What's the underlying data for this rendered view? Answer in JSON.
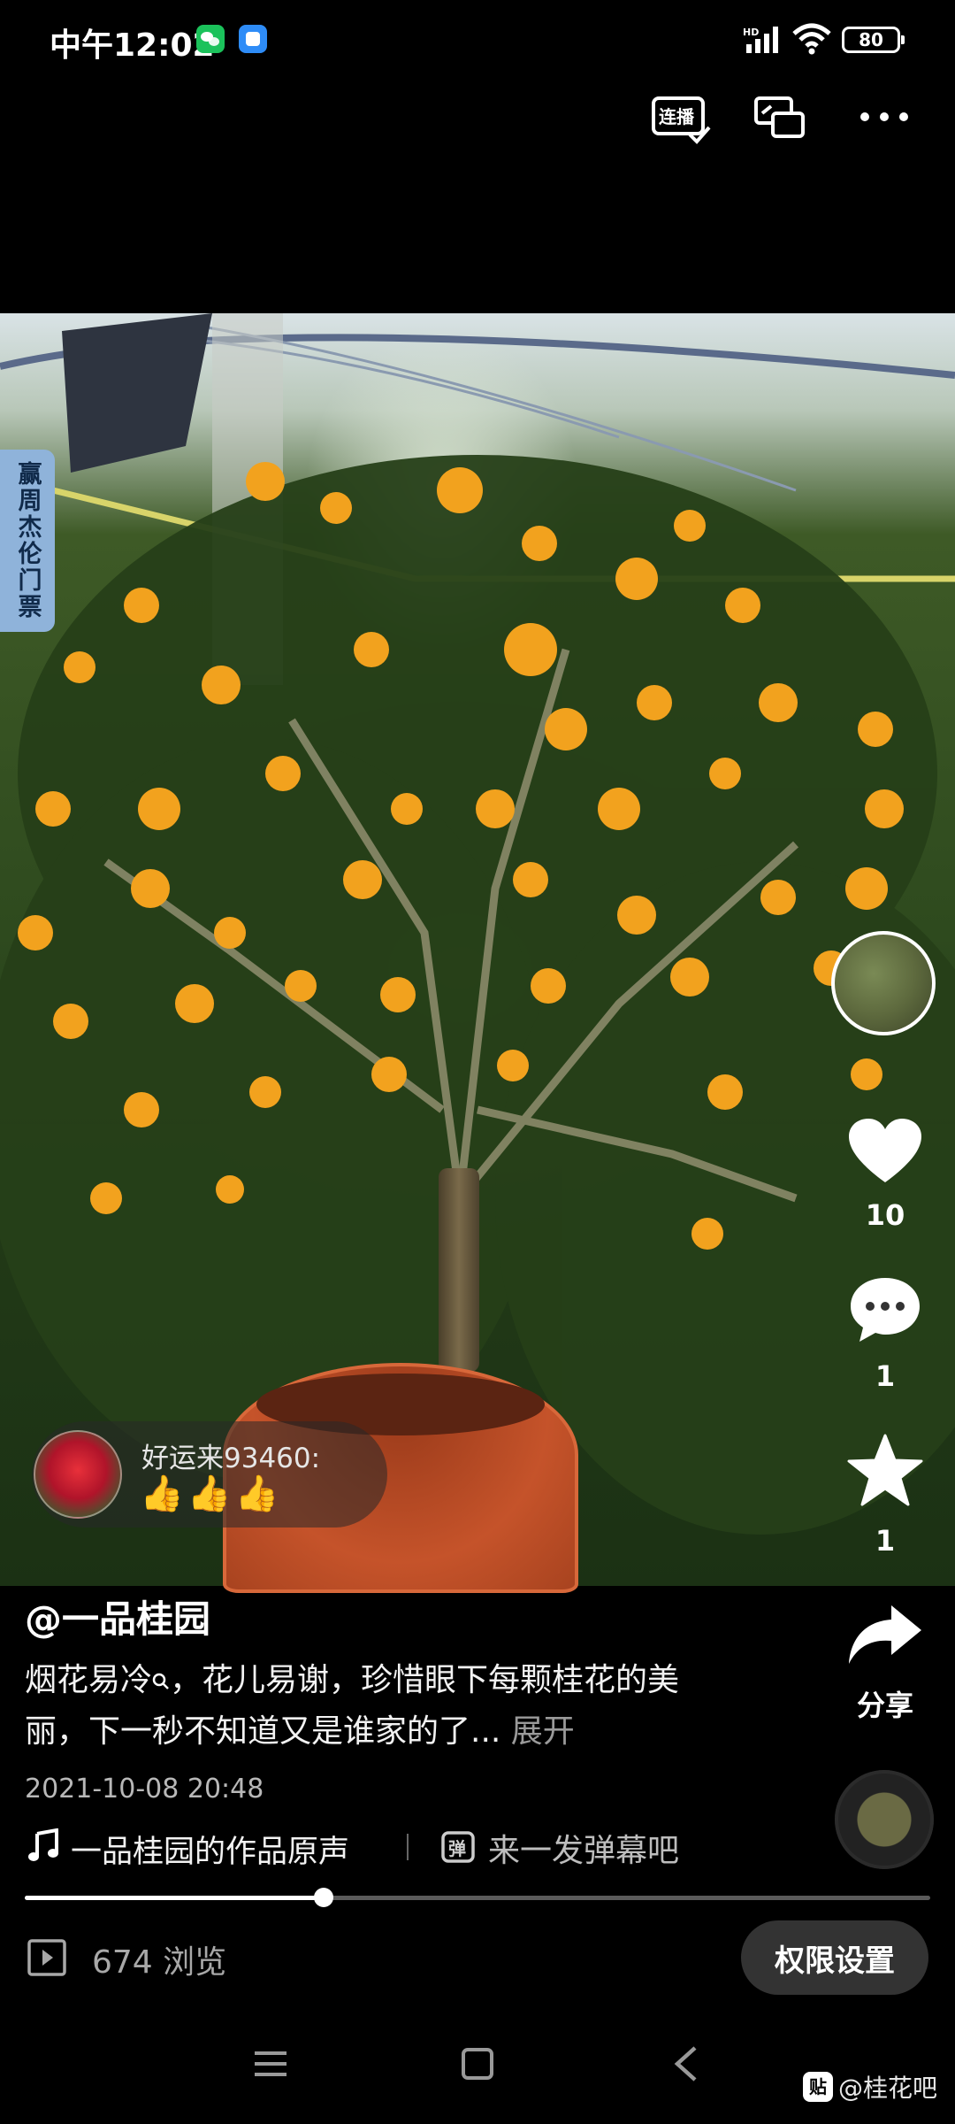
{
  "status_bar": {
    "time": "中午12:02",
    "battery": "80",
    "network_label": "HD"
  },
  "top_bar": {
    "autoplay_label": "连播"
  },
  "promo_badge": "赢周杰伦门票",
  "interactions": {
    "likes": "10",
    "comments": "1",
    "favorites": "1",
    "share_label": "分享"
  },
  "danmaku": {
    "user": "好运来93460:",
    "text": "👍👍👍"
  },
  "post": {
    "author": "@一品桂园",
    "caption": "烟花易冷",
    "caption_rest": "，花儿易谢，珍惜眼下每颗桂花的美丽，下一秒不知道又是谁家的了...",
    "expand": "展开",
    "time": "2021-10-08 20:48",
    "music": "一品桂园的作品原声",
    "danmaku_placeholder": "来一发弹幕吧"
  },
  "playback": {
    "progress": 0.33
  },
  "footer": {
    "views": "674 浏览",
    "permission_button": "权限设置"
  },
  "watermark": {
    "logo": "贴",
    "text": "@桂花吧"
  },
  "colors": {
    "background": "#000000",
    "blossom": "#f0a020",
    "foliage": "#2e4a1e"
  }
}
